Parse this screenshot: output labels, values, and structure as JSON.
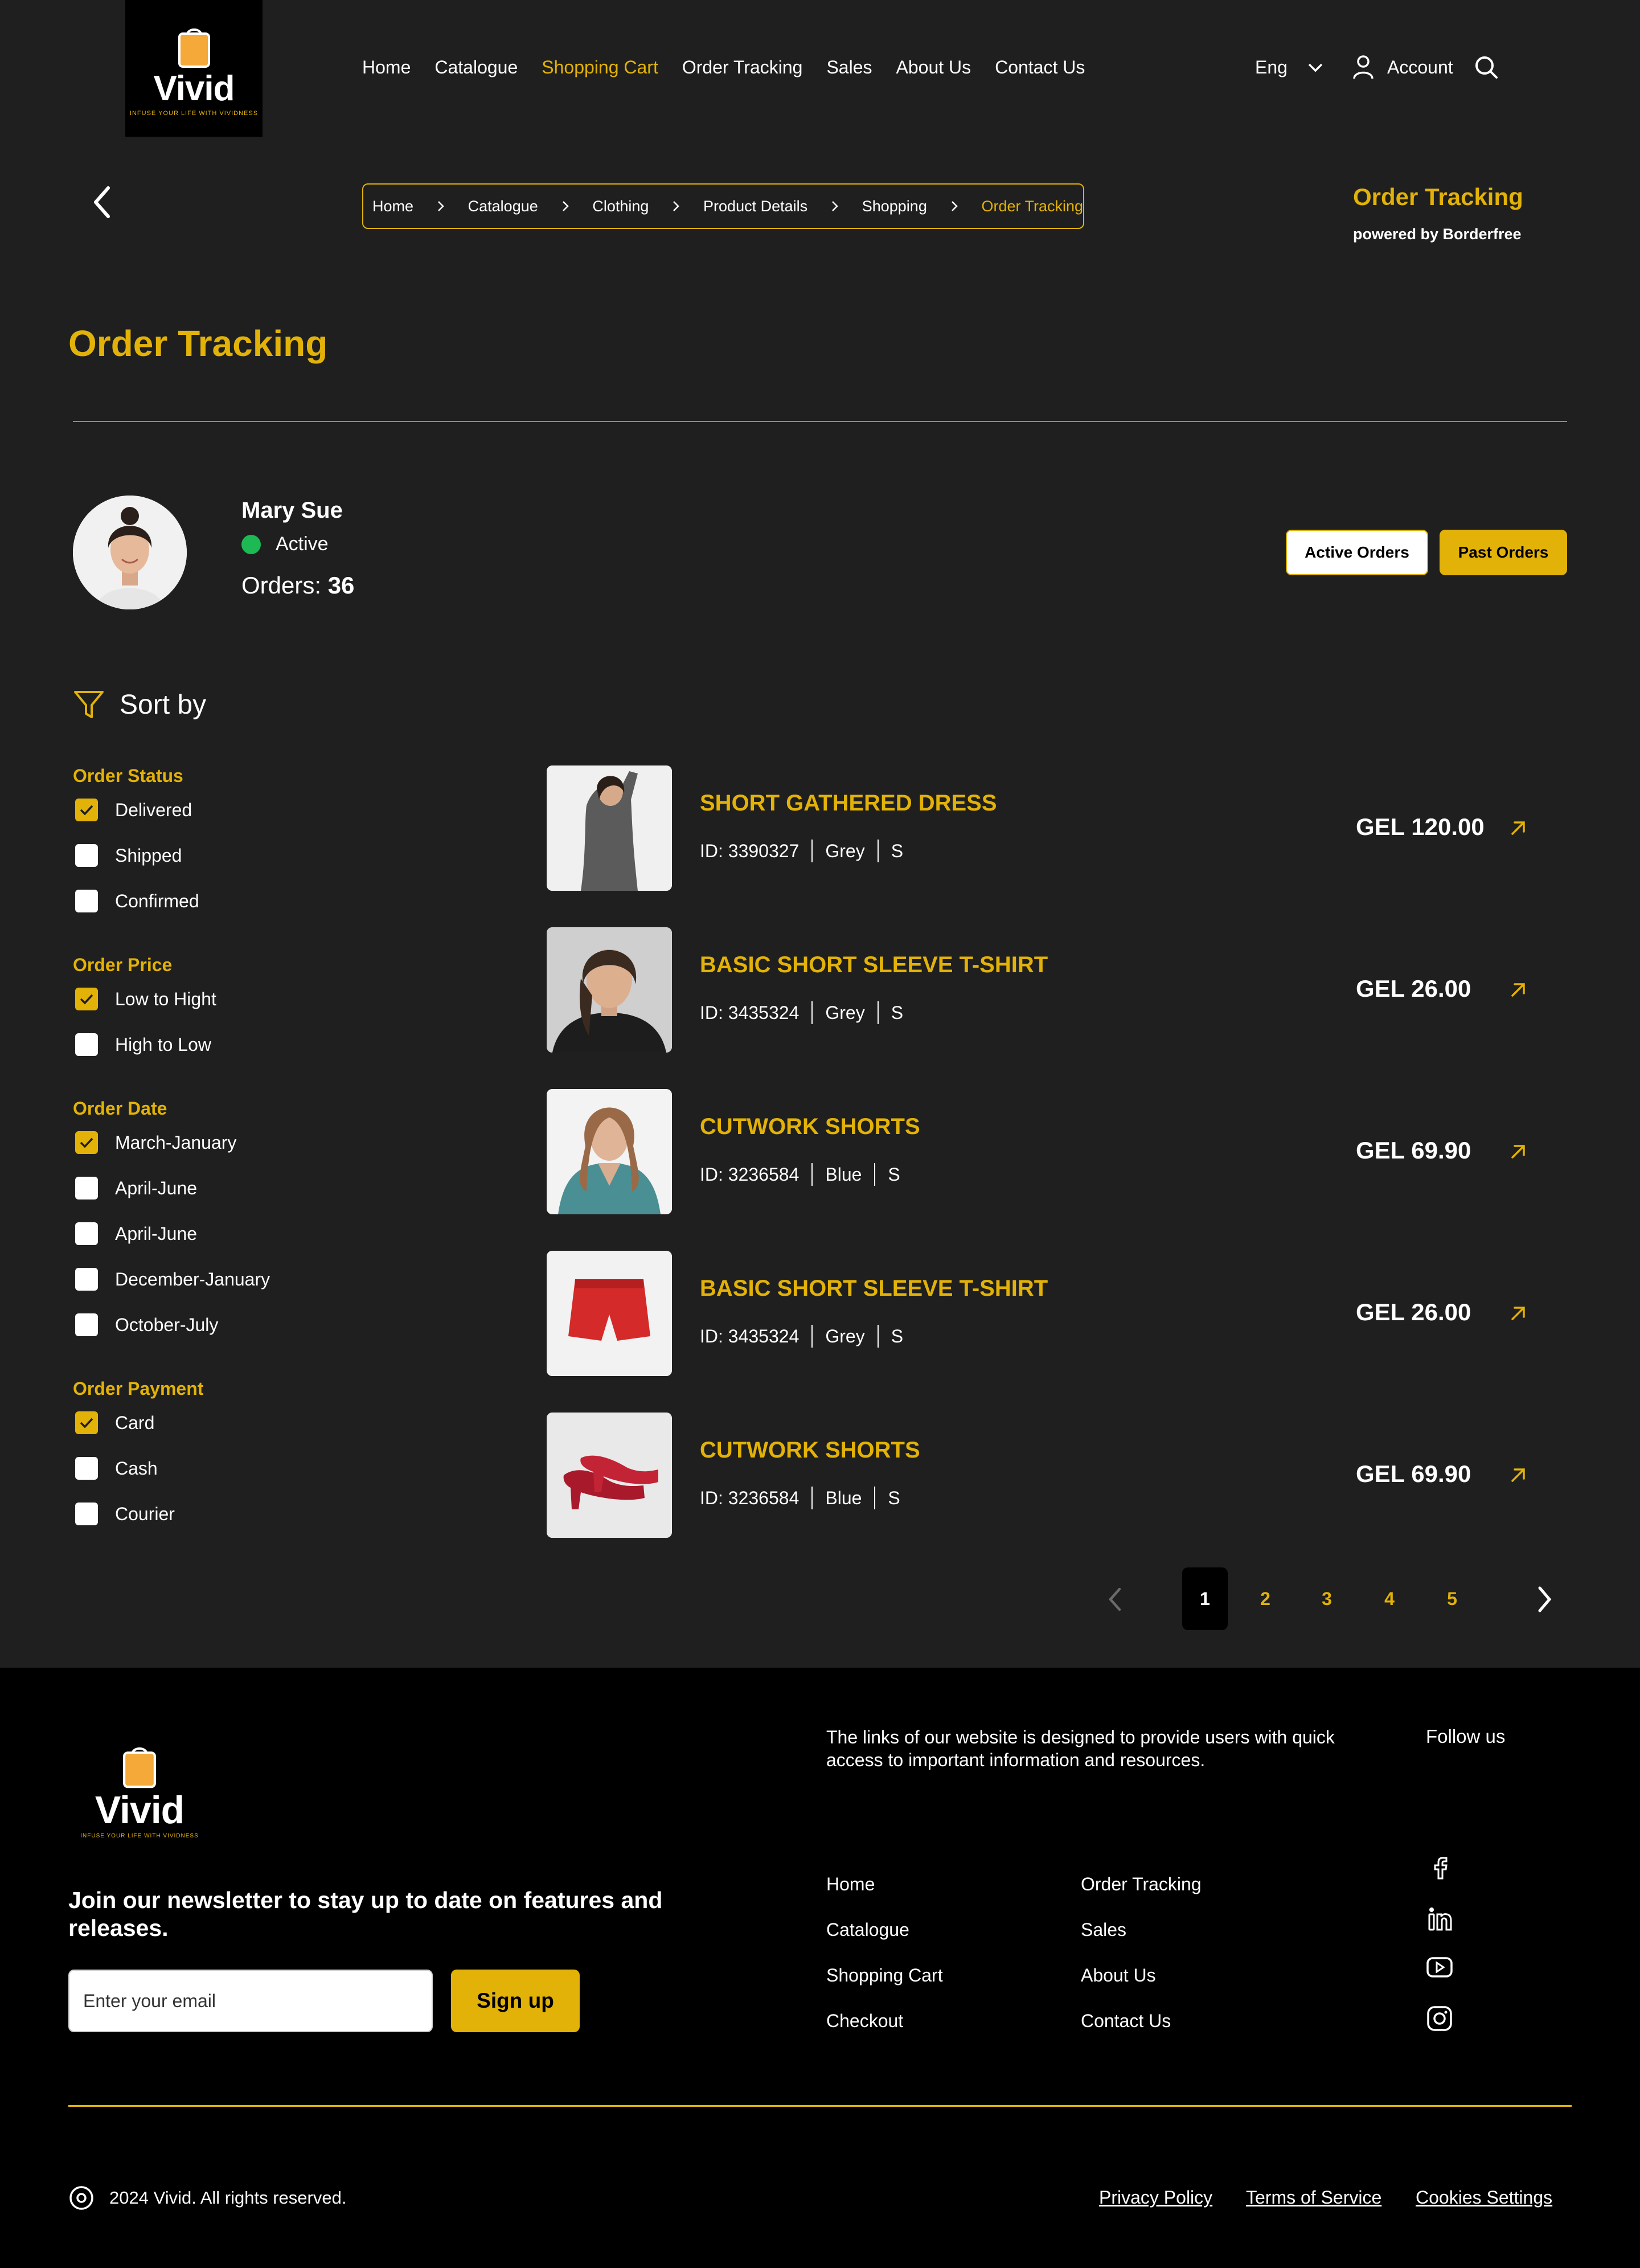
{
  "brand": {
    "name": "Vivid",
    "tagline": "INFUSE YOUR LIFE WITH VIVIDNESS",
    "accent": "#e2b208",
    "bg": "#1f1f1f"
  },
  "nav": [
    {
      "label": "Home",
      "active": false
    },
    {
      "label": "Catalogue",
      "active": false
    },
    {
      "label": "Shopping Cart",
      "active": true
    },
    {
      "label": "Order Tracking",
      "active": false
    },
    {
      "label": "Sales",
      "active": false
    },
    {
      "label": "About Us",
      "active": false
    },
    {
      "label": "Contact Us",
      "active": false
    }
  ],
  "header": {
    "language": "Eng",
    "account_label": "Account",
    "icons": [
      "user-icon",
      "search-icon",
      "chevron-down-icon"
    ]
  },
  "breadcrumb": [
    "Home",
    "Catalogue",
    "Clothing",
    "Product Details",
    "Shopping",
    "Order Tracking"
  ],
  "powered": {
    "title": "Order Tracking",
    "subtitle": "powered by Borderfree"
  },
  "page_title": "Order Tracking",
  "user": {
    "name": "Mary Sue",
    "status": "Active",
    "status_color": "#1db954",
    "orders_label": "Orders:",
    "orders_count": "36"
  },
  "tabs": {
    "active_orders": "Active Orders",
    "past_orders": "Past Orders"
  },
  "sort": {
    "label": "Sort by"
  },
  "filters": [
    {
      "title": "Order Status",
      "options": [
        {
          "label": "Delivered",
          "checked": true
        },
        {
          "label": "Shipped",
          "checked": false
        },
        {
          "label": "Confirmed",
          "checked": false
        }
      ]
    },
    {
      "title": "Order Price",
      "options": [
        {
          "label": "Low to Hight",
          "checked": true
        },
        {
          "label": "High to Low",
          "checked": false
        }
      ]
    },
    {
      "title": "Order Date",
      "options": [
        {
          "label": "March-January",
          "checked": true
        },
        {
          "label": "April-June",
          "checked": false
        },
        {
          "label": "April-June",
          "checked": false
        },
        {
          "label": "December-January",
          "checked": false
        },
        {
          "label": "October-July",
          "checked": false
        }
      ]
    },
    {
      "title": "Order Payment",
      "options": [
        {
          "label": "Card",
          "checked": true
        },
        {
          "label": "Cash",
          "checked": false
        },
        {
          "label": "Courier",
          "checked": false
        }
      ]
    }
  ],
  "orders": [
    {
      "name": "SHORT GATHERED DRESS",
      "id": "ID: 3390327",
      "color": "Grey",
      "size": "S",
      "price": "GEL 120.00",
      "image": "model-grey-dress"
    },
    {
      "name": "BASIC SHORT SLEEVE T-SHIRT",
      "id": "ID: 3435324",
      "color": "Grey",
      "size": "S",
      "price": "GEL 26.00",
      "image": "model-black-tshirt"
    },
    {
      "name": "CUTWORK SHORTS",
      "id": "ID: 3236584",
      "color": "Blue",
      "size": "S",
      "price": "GEL 69.90",
      "image": "model-teal-cardigan"
    },
    {
      "name": "BASIC SHORT SLEEVE T-SHIRT",
      "id": "ID: 3435324",
      "color": "Grey",
      "size": "S",
      "price": "GEL 26.00",
      "image": "red-shorts"
    },
    {
      "name": "CUTWORK SHORTS",
      "id": "ID: 3236584",
      "color": "Blue",
      "size": "S",
      "price": "GEL 69.90",
      "image": "red-shoes"
    }
  ],
  "pagination": {
    "pages": [
      "1",
      "2",
      "3",
      "4",
      "5"
    ],
    "current": "1"
  },
  "footer": {
    "description": "The links of our website is designed to provide users with quick access to important information and resources.",
    "follow_label": "Follow us",
    "newsletter_title": "Join our newsletter to stay up to date on features and releases.",
    "email_placeholder": "Enter your email",
    "signup_label": "Sign up",
    "links_col1": [
      "Home",
      "Catalogue",
      "Shopping Cart",
      "Checkout"
    ],
    "links_col2": [
      "Order Tracking",
      "Sales",
      "About Us",
      "Contact Us"
    ],
    "social": [
      "facebook-icon",
      "linkedin-icon",
      "youtube-icon",
      "instagram-icon"
    ],
    "copyright": "2024 Vivid. All rights reserved.",
    "legal": [
      "Privacy Policy",
      "Terms of Service",
      "Cookies Settings"
    ]
  }
}
